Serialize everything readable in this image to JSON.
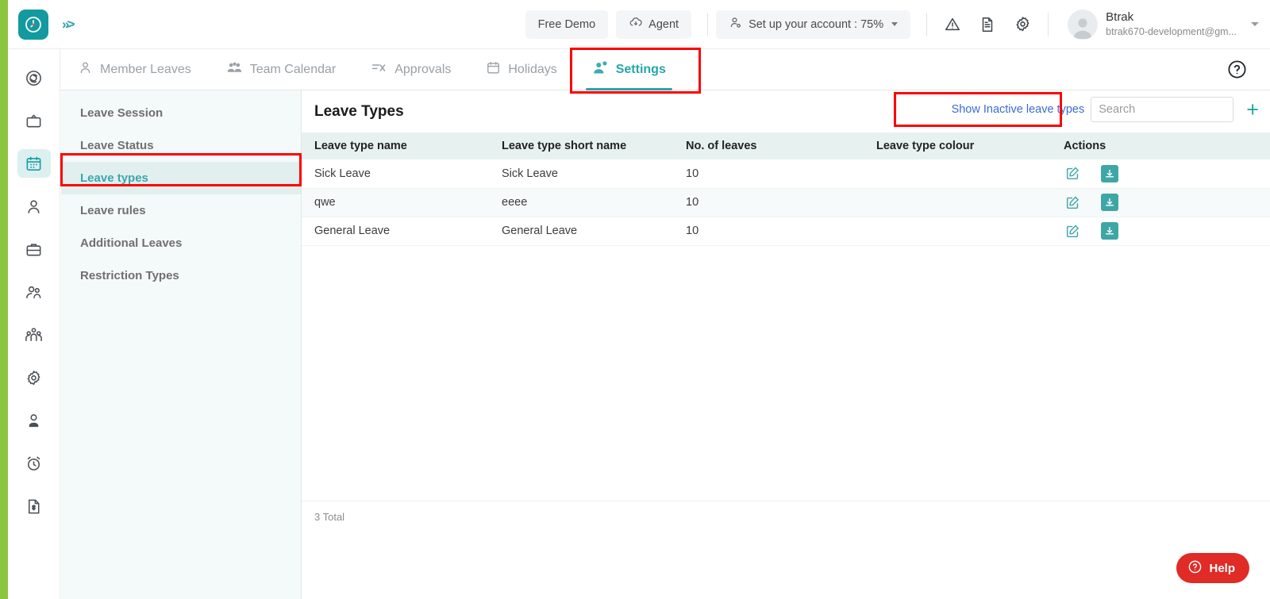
{
  "header": {
    "logo_icon": "clock-logo-icon",
    "expand_icon": "chevrons-right-icon",
    "free_demo_label": "Free Demo",
    "agent_label": "Agent",
    "agent_icon": "cloud-download-icon",
    "setup_label": "Set up your account : 75%",
    "setup_icon": "user-gear-icon",
    "warning_icon": "warning-triangle-icon",
    "document_icon": "document-icon",
    "settings_icon": "gear-icon",
    "profile_name": "Btrak",
    "profile_email": "btrak670-development@gm...",
    "avatar_icon": "user-avatar"
  },
  "tabs": [
    {
      "label": "Member Leaves",
      "icon": "person-icon",
      "active": false
    },
    {
      "label": "Team Calendar",
      "icon": "people-group-icon",
      "active": false
    },
    {
      "label": "Approvals",
      "icon": "approvals-list-icon",
      "active": false
    },
    {
      "label": "Holidays",
      "icon": "calendar-icon",
      "active": false
    },
    {
      "label": "Settings",
      "icon": "user-settings-icon",
      "active": true
    }
  ],
  "tabbar_help_icon": "question-circle-icon",
  "rail": [
    {
      "icon": "spiral-icon",
      "active": false
    },
    {
      "icon": "tv-icon",
      "active": false
    },
    {
      "icon": "calendar-icon",
      "active": true
    },
    {
      "icon": "person-icon",
      "active": false
    },
    {
      "icon": "briefcase-icon",
      "active": false
    },
    {
      "icon": "people-icon",
      "active": false
    },
    {
      "icon": "team-group-icon",
      "active": false
    },
    {
      "icon": "gear-icon",
      "active": false
    },
    {
      "icon": "user-profile-icon",
      "active": false
    },
    {
      "icon": "alarm-clock-icon",
      "active": false
    },
    {
      "icon": "invoice-icon",
      "active": false
    }
  ],
  "subnav": {
    "items": [
      {
        "label": "Leave Session",
        "active": false
      },
      {
        "label": "Leave Status",
        "active": false
      },
      {
        "label": "Leave types",
        "active": true
      },
      {
        "label": "Leave rules",
        "active": false
      },
      {
        "label": "Additional Leaves",
        "active": false
      },
      {
        "label": "Restriction Types",
        "active": false
      }
    ]
  },
  "main": {
    "title": "Leave Types",
    "show_inactive_label": "Show Inactive leave types",
    "search_placeholder": "Search",
    "search_value": "",
    "add_icon": "plus-icon",
    "columns": [
      "Leave type name",
      "Leave type short name",
      "No. of leaves",
      "Leave type colour",
      "Actions"
    ],
    "rows": [
      {
        "name": "Sick Leave",
        "short_name": "Sick Leave",
        "no_of_leaves": "10",
        "colour": ""
      },
      {
        "name": "qwe",
        "short_name": "eeee",
        "no_of_leaves": "10",
        "colour": ""
      },
      {
        "name": "General Leave",
        "short_name": "General Leave",
        "no_of_leaves": "10",
        "colour": ""
      }
    ],
    "row_action_edit_icon": "edit-pencil-icon",
    "row_action_archive_icon": "archive-download-icon",
    "total_label": "3 Total"
  },
  "help_fab": {
    "label": "Help",
    "icon": "question-circle-icon"
  },
  "colors": {
    "brand_teal": "#139AA0",
    "accent_teal": "#23A6AC",
    "link_blue": "#3b6cd4",
    "green_edge": "#8CC63F",
    "help_red": "#E02B27",
    "annotation_red": "#FF0000",
    "table_header_bg": "#E6F1F0",
    "subnav_bg": "#F4F9F9"
  }
}
